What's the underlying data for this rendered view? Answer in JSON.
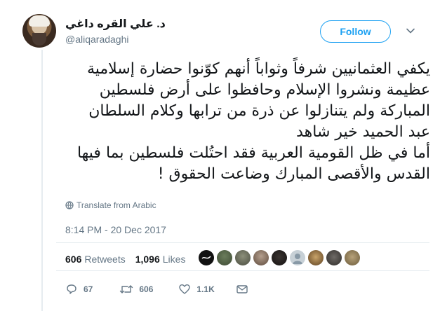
{
  "author": {
    "display_name": "د. علي القره داغي",
    "handle": "@aliqaradaghi"
  },
  "follow_button": {
    "label": "Follow"
  },
  "tweet": {
    "lines": [
      "يكفي العثمانيين شرفاً وثواباً أنهم كوّنوا حضارة إسلامية",
      "عظيمة ونشروا الإسلام وحافظوا على أرض فلسطين",
      "المباركة ولم يتنازلوا عن ذرة من ترابها وكلام السلطان",
      "عبد الحميد خير شاهد",
      "أما في ظل القومية العربية فقد احتُلت فلسطين بما فيها",
      "القدس والأقصى المبارك وضاعت الحقوق !"
    ],
    "translate_label": "Translate from Arabic",
    "timestamp": "8:14 PM - 20 Dec 2017"
  },
  "stats": {
    "retweets_count": "606",
    "retweets_label": "Retweets",
    "likes_count": "1,096",
    "likes_label": "Likes"
  },
  "actions": {
    "reply_count": "67",
    "retweet_count": "606",
    "like_count": "1.1K"
  },
  "colors": {
    "accent": "#1da1f2",
    "secondary_text": "#657786",
    "divider": "#e6ecf0"
  }
}
